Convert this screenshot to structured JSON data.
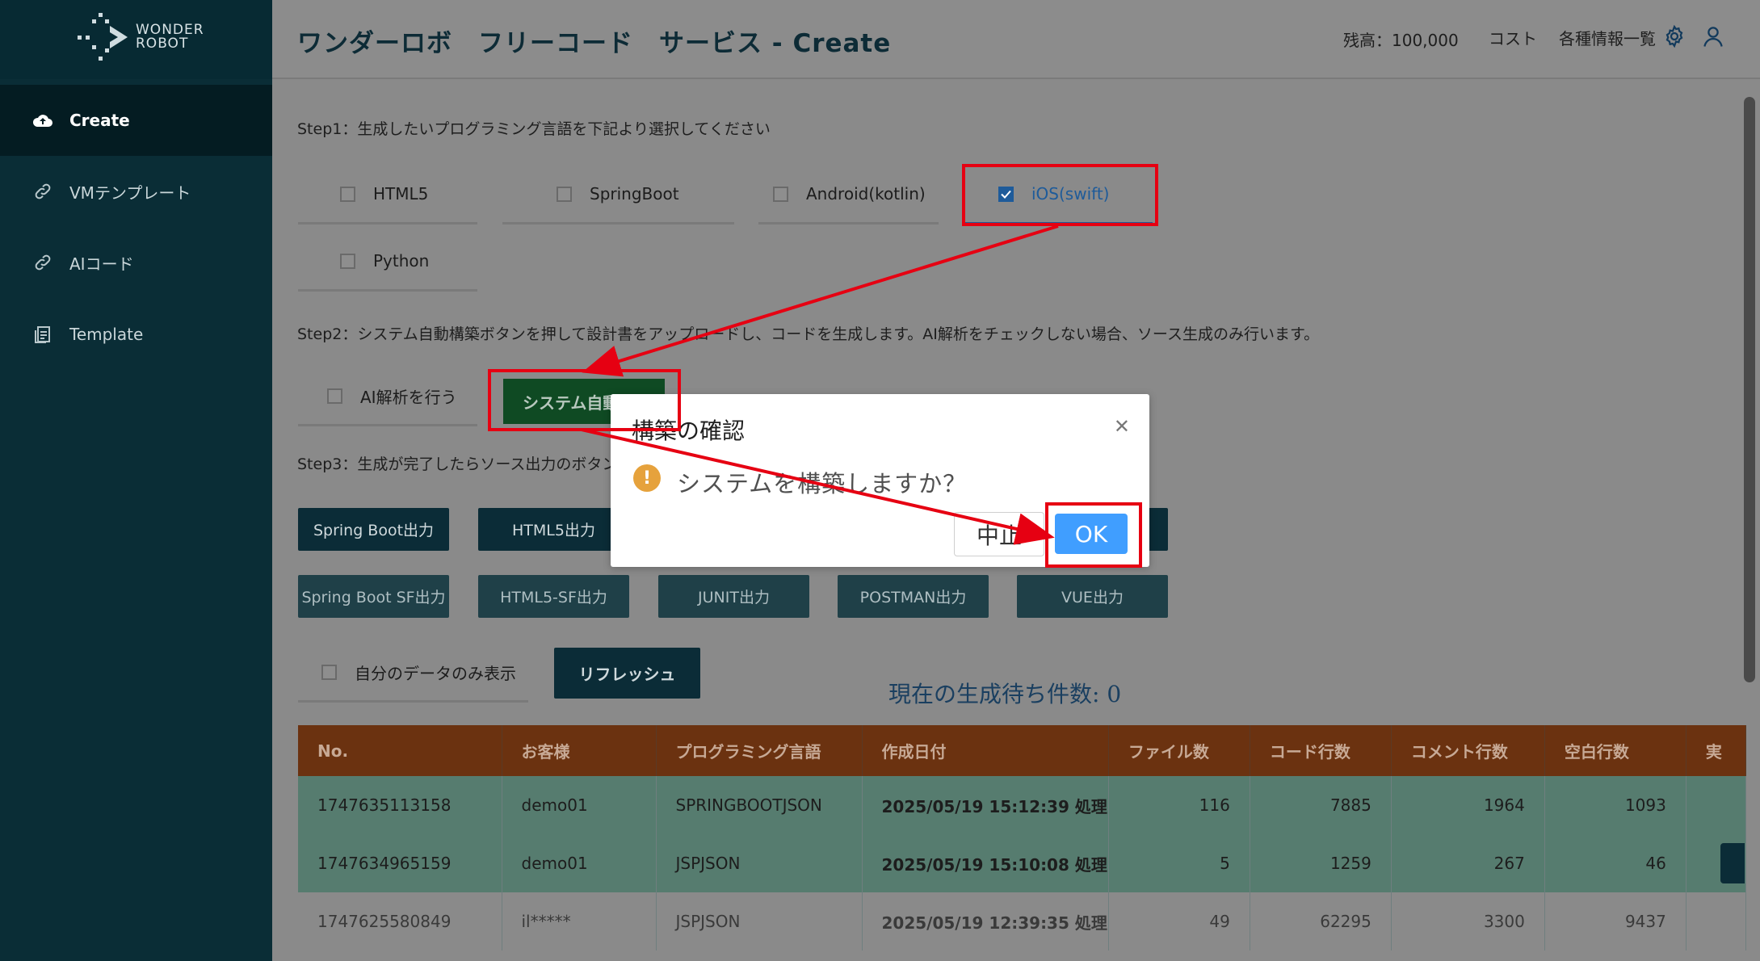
{
  "brand": {
    "line1": "WONDER",
    "line2": "ROBOT"
  },
  "sidebar": {
    "items": [
      {
        "label": "Create",
        "icon": "cloud-upload-icon",
        "active": true
      },
      {
        "label": "VMテンプレート",
        "icon": "link-icon"
      },
      {
        "label": "AIコード",
        "icon": "link-icon"
      },
      {
        "label": "Template",
        "icon": "document-icon"
      }
    ]
  },
  "header": {
    "title": "ワンダーロボ　フリーコード　サービス - Create",
    "balance": "残高：100,000",
    "cost": "コスト",
    "info_list": "各種情報一覧"
  },
  "step1": {
    "text": "Step1：生成したいプログラミング言語を下記より選択してください",
    "options": [
      {
        "label": "HTML5",
        "checked": false
      },
      {
        "label": "SpringBoot",
        "checked": false
      },
      {
        "label": "Android(kotlin)",
        "checked": false
      },
      {
        "label": "iOS(swift)",
        "checked": true
      },
      {
        "label": "Python",
        "checked": false
      }
    ]
  },
  "step2": {
    "text": "Step2：システム自動構築ボタンを押して設計書をアップロードし、コードを生成します。AI解析をチェックしない場合、ソース生成のみ行います。",
    "ai_checkbox": "AI解析を行う",
    "build_button": "システム自動構築"
  },
  "step3": {
    "text": "Step3：生成が完了したらソース出力のボタン",
    "row1": [
      "Spring Boot出力",
      "HTML5出力",
      "",
      "",
      ""
    ],
    "row2": [
      "Spring Boot SF出力",
      "HTML5-SF出力",
      "JUNIT出力",
      "POSTMAN出力",
      "VUE出力"
    ]
  },
  "filter": {
    "own_data": "自分のデータのみ表示",
    "refresh": "リフレッシュ"
  },
  "queue": {
    "text": "現在の生成待ち件数: 0"
  },
  "table": {
    "headers": [
      "No.",
      "お客様",
      "プログラミング言語",
      "作成日付",
      "ファイル数",
      "コード行数",
      "コメント行数",
      "空白行数",
      "実"
    ],
    "rows": [
      {
        "no": "1747635113158",
        "customer": "demo01",
        "lang": "SPRINGBOOTJSON",
        "date": "2025/05/19 15:12:39 処理",
        "files": "116",
        "code": "7885",
        "comment": "1964",
        "blank": "1093"
      },
      {
        "no": "1747634965159",
        "customer": "demo01",
        "lang": "JSPJSON",
        "date": "2025/05/19 15:10:08 処理",
        "files": "5",
        "code": "1259",
        "comment": "267",
        "blank": "46"
      },
      {
        "no": "1747625580849",
        "customer": "il*****",
        "lang": "JSPJSON",
        "date": "2025/05/19 12:39:35 処理",
        "files": "49",
        "code": "62295",
        "comment": "3300",
        "blank": "9437"
      }
    ]
  },
  "modal": {
    "title": "構築の確認",
    "message": "システムを構築しますか？",
    "cancel": "中止",
    "ok": "OK"
  },
  "colors": {
    "annotation": "#e60012",
    "ok_button": "#409eff",
    "header_bg": "#6b3210"
  }
}
